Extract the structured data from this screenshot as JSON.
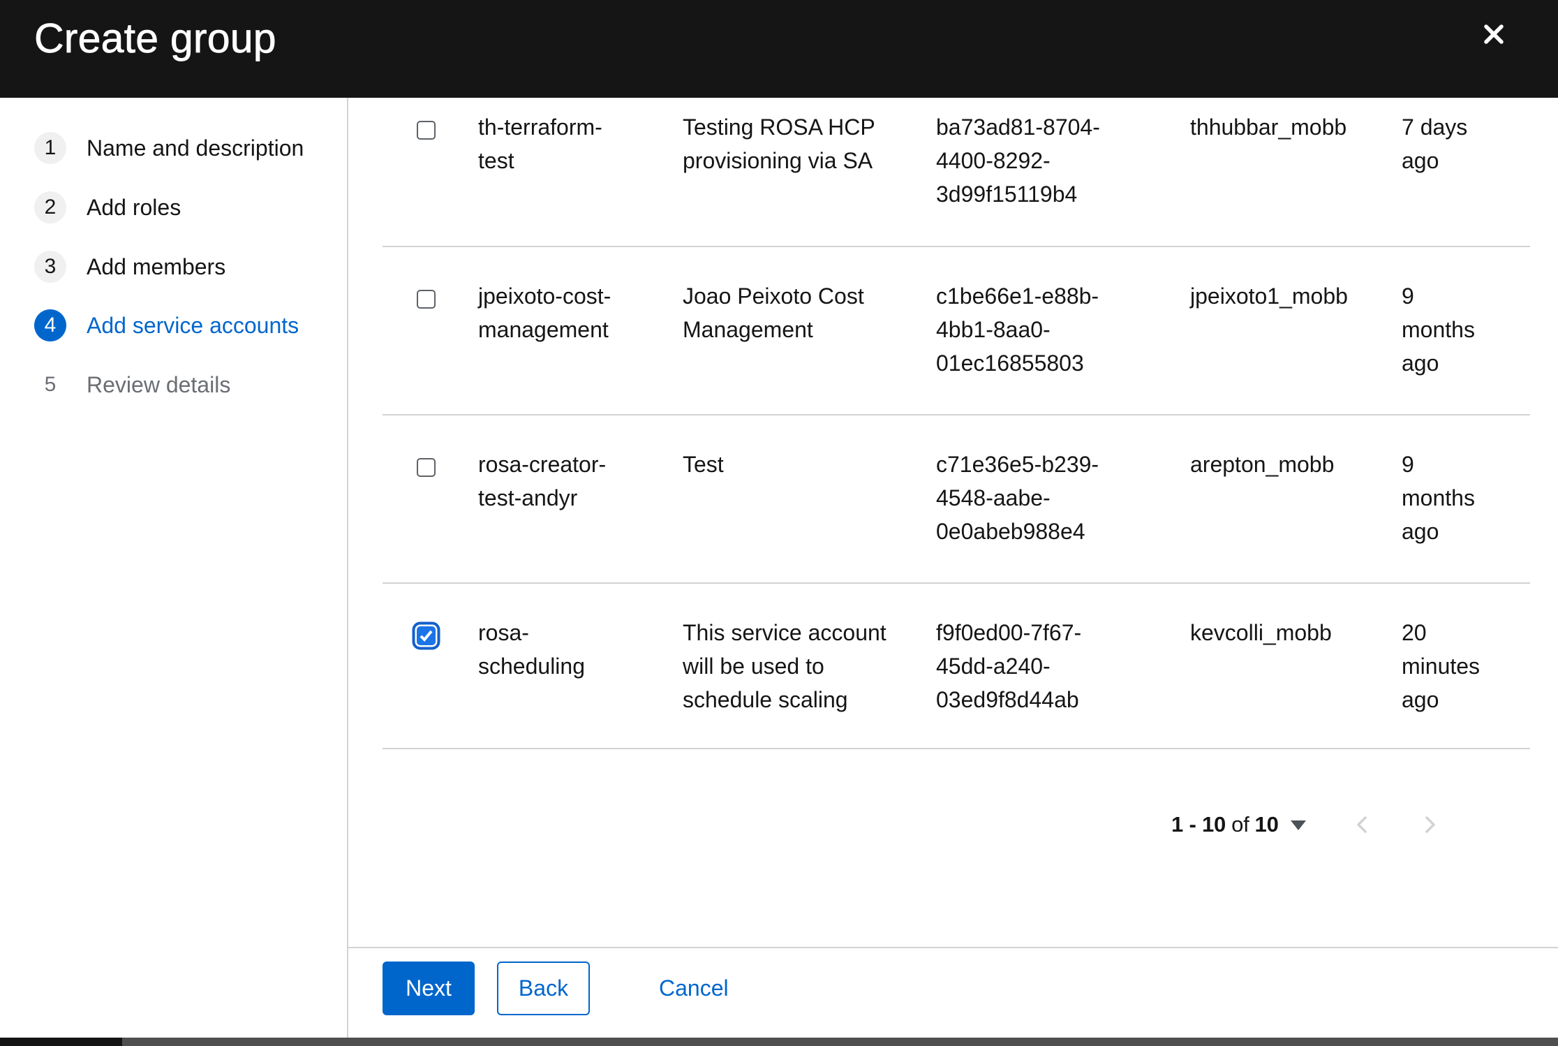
{
  "header": {
    "title": "Create group",
    "close_label": "Close"
  },
  "wizard": {
    "steps": [
      {
        "number": "1",
        "label": "Name and description",
        "state": "visited"
      },
      {
        "number": "2",
        "label": "Add roles",
        "state": "visited"
      },
      {
        "number": "3",
        "label": "Add members",
        "state": "visited"
      },
      {
        "number": "4",
        "label": "Add service accounts",
        "state": "current"
      },
      {
        "number": "5",
        "label": "Review details",
        "state": "upcoming"
      }
    ]
  },
  "table": {
    "rows": [
      {
        "selected": false,
        "name": "th-terraform-\ntest",
        "description": "Testing ROSA HCP\nprovisioning via SA",
        "client_id": "ba73ad81-8704-\n4400-8292-\n3d99f15119b4",
        "owner": "thhubbar_mobb",
        "time_created": "7 days\nago"
      },
      {
        "selected": false,
        "name": "jpeixoto-cost-\nmanagement",
        "description": "Joao Peixoto Cost\nManagement",
        "client_id": "c1be66e1-e88b-\n4bb1-8aa0-\n01ec16855803",
        "owner": "jpeixoto1_mobb",
        "time_created": "9\nmonths\nago"
      },
      {
        "selected": false,
        "name": "rosa-creator-\ntest-andyr",
        "description": "Test",
        "client_id": "c71e36e5-b239-\n4548-aabe-\n0e0abeb988e4",
        "owner": "arepton_mobb",
        "time_created": "9\nmonths\nago"
      },
      {
        "selected": true,
        "name": "rosa-\nscheduling",
        "description": "This service account\nwill be used to\nschedule scaling",
        "client_id": "f9f0ed00-7f67-\n45dd-a240-\n03ed9f8d44ab",
        "owner": "kevcolli_mobb",
        "time_created": "20\nminutes\nago"
      }
    ]
  },
  "pagination": {
    "range": "1 - 10",
    "of_word": "of",
    "total": "10"
  },
  "footer": {
    "next_label": "Next",
    "back_label": "Back",
    "cancel_label": "Cancel"
  },
  "colors": {
    "header_bg": "#151515",
    "primary_blue": "#0066cc",
    "checkbox_checked_blue": "#1b74e8",
    "border_gray": "#d2d2d2",
    "muted_text": "#6a6e73",
    "step_bullet_bg": "#f0f0f0"
  }
}
